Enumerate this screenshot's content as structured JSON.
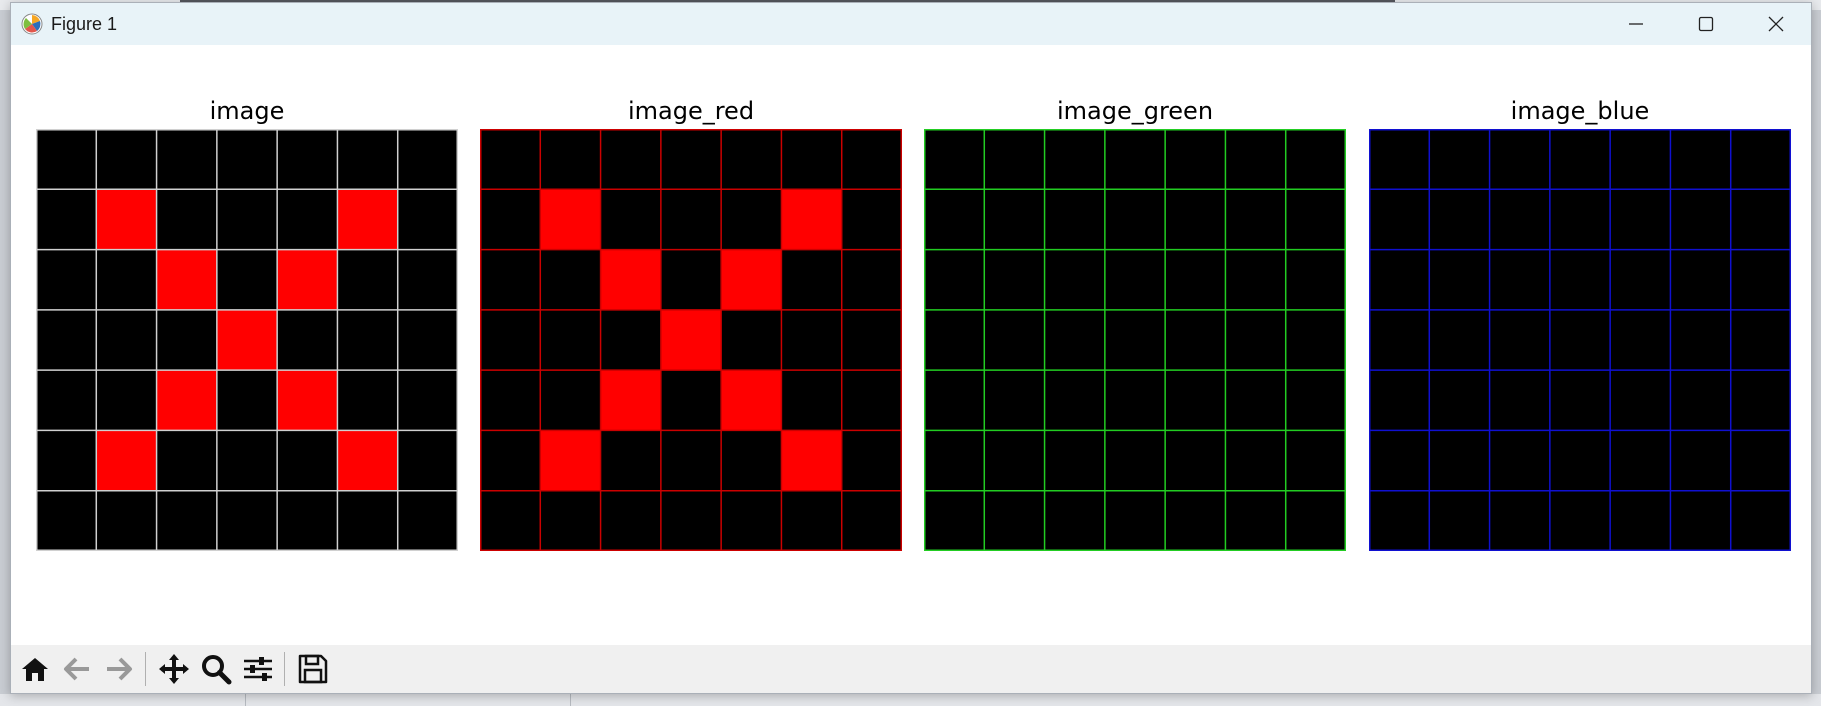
{
  "window": {
    "title": "Figure 1"
  },
  "figure": {
    "panels": [
      {
        "title": "image",
        "grid_color": "#d0d0d0"
      },
      {
        "title": "image_red",
        "grid_color": "#cc0000"
      },
      {
        "title": "image_green",
        "grid_color": "#22cc22"
      },
      {
        "title": "image_blue",
        "grid_color": "#1010d0"
      }
    ],
    "pixel_size": 7,
    "lit_cells": [
      [
        1,
        1
      ],
      [
        1,
        5
      ],
      [
        2,
        2
      ],
      [
        2,
        4
      ],
      [
        3,
        3
      ],
      [
        4,
        2
      ],
      [
        4,
        4
      ],
      [
        5,
        1
      ],
      [
        5,
        5
      ]
    ],
    "lit_color_by_panel": [
      "#ff0000",
      "#ff0000",
      null,
      null
    ],
    "background_color": "#000000"
  },
  "toolbar": {
    "icons": [
      "home-icon",
      "back-arrow-icon",
      "forward-arrow-icon",
      "pan-icon",
      "zoom-icon",
      "configure-subplots-icon",
      "save-icon"
    ]
  }
}
